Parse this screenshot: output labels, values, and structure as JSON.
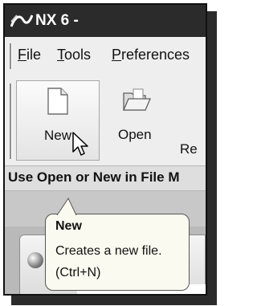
{
  "window": {
    "title": "NX 6 -",
    "logo_icon": "nx-logo-icon"
  },
  "menu": [
    {
      "label": "File",
      "underline": "F",
      "rest": "ile"
    },
    {
      "label": "Tools",
      "underline": "T",
      "rest": "ools"
    },
    {
      "label": "Preferences",
      "underline": "P",
      "rest": "references"
    }
  ],
  "toolbar": {
    "new": {
      "label": "New",
      "icon": "new-file-icon"
    },
    "open": {
      "label": "Open",
      "icon": "open-folder-icon"
    },
    "partial_label": "Re"
  },
  "cue_line": {
    "text": "Use Open or New in File M"
  },
  "tooltip": {
    "title": "New",
    "description": "Creates a new file.",
    "shortcut": "(Ctrl+N)"
  },
  "colors": {
    "titlebar": "#2b2b2b",
    "toolbar_bg": "#eeeeee",
    "tooltip_bg": "#fafaf0"
  }
}
